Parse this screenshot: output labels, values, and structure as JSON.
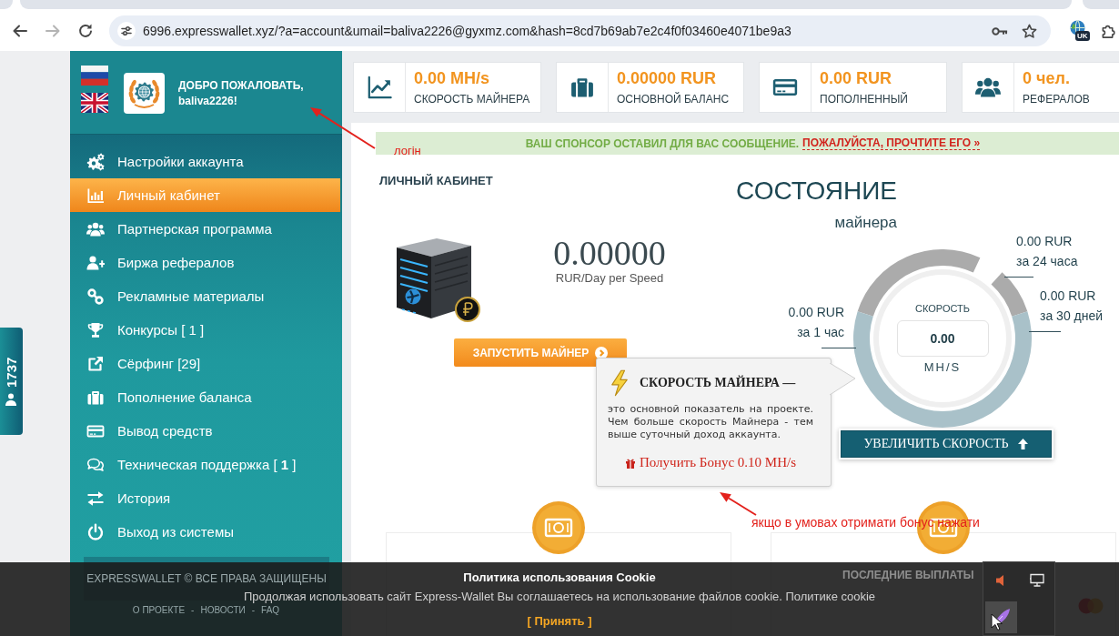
{
  "browser": {
    "url": "6996.expresswallet.xyz/?a=account&umail=baliva2226@gyxmz.com&hash=8cd7b69ab7e2c4f0f03460e4071be9a3",
    "extension_badge": "UK"
  },
  "online_tab": {
    "count": "1737"
  },
  "sidebar": {
    "languages": [
      {
        "kind": "ru"
      },
      {
        "kind": "en"
      }
    ],
    "welcome": "ДОБРО ПОЖАЛОВАТЬ, baliva2226!",
    "items": [
      {
        "kind": "settings",
        "label": "Настройки аккаунта",
        "selected": false
      },
      {
        "kind": "dashboard",
        "label": "Личный кабинет",
        "selected": true
      },
      {
        "kind": "partners",
        "label": "Партнерская программа",
        "selected": false
      },
      {
        "kind": "referral_exchange",
        "label": "Биржа рефералов",
        "selected": false
      },
      {
        "kind": "promo",
        "label": "Рекламные материалы",
        "selected": false
      },
      {
        "kind": "contests",
        "label": "Конкурсы [ 1 ]",
        "selected": false
      },
      {
        "kind": "surfing",
        "label": "Сёрфинг [29]",
        "selected": false
      },
      {
        "kind": "deposit",
        "label": "Пополнение баланса",
        "selected": false
      },
      {
        "kind": "withdraw",
        "label": "Вывод средств",
        "selected": false
      },
      {
        "kind": "support",
        "label": "Техническая поддержка [ **1** ]",
        "selected": false
      },
      {
        "kind": "history",
        "label": "История",
        "selected": false
      },
      {
        "kind": "logout",
        "label": "Выход из системы",
        "selected": false
      }
    ],
    "footer": {
      "copyright": "EXPRESSWALLET © ВСЕ ПРАВА ЗАЩИЩЕНЫ",
      "links": [
        "О ПРОЕКТЕ",
        "НОВОСТИ",
        "FAQ"
      ],
      "separator": "-"
    }
  },
  "stats": [
    {
      "kind": "speed",
      "value": "0.00 MH/s",
      "label": "СКОРОСТЬ МАЙНЕРА"
    },
    {
      "kind": "balance",
      "value": "0.00000 RUR",
      "label": "ОСНОВНОЙ БАЛАНС"
    },
    {
      "kind": "deposit",
      "value": "0.00 RUR",
      "label": "ПОПОЛНЕННЫЙ"
    },
    {
      "kind": "referrals",
      "value": "0 чел.",
      "label": "РЕФЕРАЛОВ"
    }
  ],
  "notice": {
    "text": "ВАШ СПОНСОР ОСТАВИЛ ДЛЯ ВАС СООБЩЕНИЕ.",
    "link": "ПОЖАЛУЙСТА, ПРОЧТИТЕ ЕГО »"
  },
  "cabinet": {
    "title": "ЛИЧНЫЙ КАБИНЕТ",
    "earnings": "0.00000",
    "earnings_unit": "RUR/Day per Speed",
    "start_button": "ЗАПУСТИТЬ МАЙНЕР"
  },
  "miner_status": {
    "title": "СОСТОЯНИЕ",
    "subtitle": "майнера",
    "speed_label": "СКОРОСТЬ",
    "speed_value": "0.00",
    "speed_unit": "MH/S",
    "periods": [
      {
        "kind": "day",
        "amount": "0.00 RUR",
        "period": "за 24 часа"
      },
      {
        "kind": "month",
        "amount": "0.00 RUR",
        "period": "за 30 дней"
      },
      {
        "kind": "hour",
        "amount": "0.00 RUR",
        "period": "за 1 час"
      }
    ],
    "boost_button": "УВЕЛИЧИТЬ СКОРОСТЬ"
  },
  "tooltip": {
    "title": "СКОРОСТЬ МАЙНЕРА —",
    "text": "это основной показатель на проекте. Чем больше скорость Майнера - тем выше суточный доход аккаунта.",
    "bonus_link": "Получить Бонус 0.10 MH/s"
  },
  "payouts": {
    "title": "ПОСЛЕДНИЕ ВЫПЛАТЫ"
  },
  "annotations": [
    {
      "kind": "login",
      "text": "логін"
    },
    {
      "kind": "bonus",
      "text": "якщо в умовах отримати бонус нажати"
    }
  ],
  "cookie_banner": {
    "title": "Политика использования Cookie",
    "text": "Продолжая использовать сайт Express-Wallet Вы соглашаетесь на использование файлов cookie. Политике cookie",
    "accept": "[ Принять ]"
  }
}
